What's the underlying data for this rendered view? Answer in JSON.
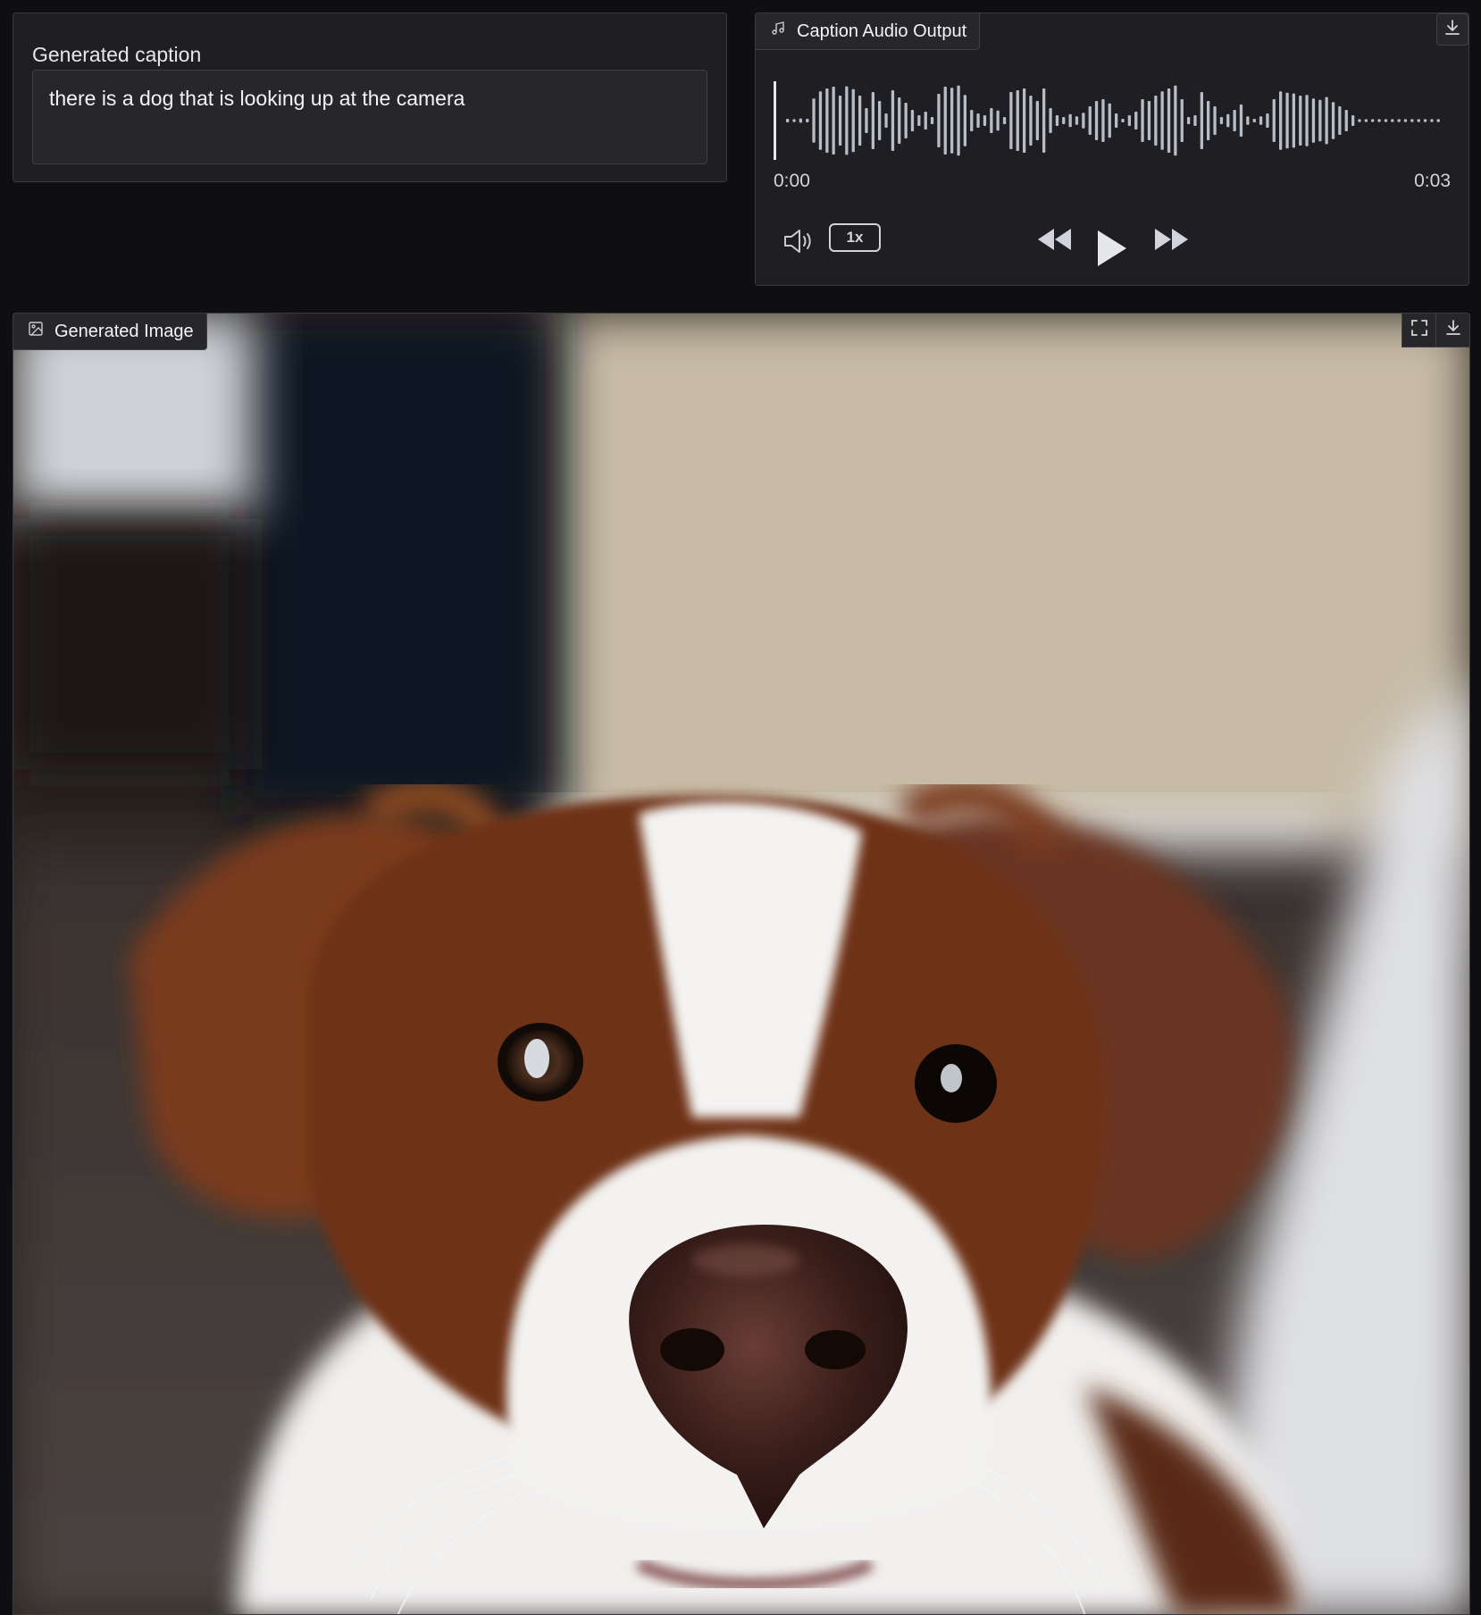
{
  "caption": {
    "label": "Generated caption",
    "text": "there is a dog that is looking up at the camera"
  },
  "audio": {
    "label": "Caption Audio Output",
    "label_icon": "music-note-icon",
    "time_current": "0:00",
    "time_total": "0:03",
    "playback_rate": "1x",
    "progress": 0,
    "waveform": [
      0.05,
      0.04,
      0.06,
      0.05,
      0.62,
      0.82,
      0.9,
      0.95,
      0.7,
      0.96,
      0.88,
      0.7,
      0.35,
      0.8,
      0.55,
      0.2,
      0.85,
      0.65,
      0.5,
      0.3,
      0.15,
      0.25,
      0.1,
      0.75,
      0.95,
      0.92,
      0.98,
      0.72,
      0.3,
      0.2,
      0.15,
      0.35,
      0.28,
      0.1,
      0.8,
      0.85,
      0.9,
      0.7,
      0.55,
      0.9,
      0.35,
      0.15,
      0.1,
      0.18,
      0.12,
      0.22,
      0.4,
      0.55,
      0.6,
      0.48,
      0.2,
      0.05,
      0.15,
      0.25,
      0.6,
      0.55,
      0.7,
      0.82,
      0.9,
      0.98,
      0.6,
      0.1,
      0.15,
      0.8,
      0.55,
      0.4,
      0.1,
      0.18,
      0.3,
      0.45,
      0.12,
      0.05,
      0.12,
      0.2,
      0.6,
      0.82,
      0.78,
      0.76,
      0.7,
      0.72,
      0.62,
      0.58,
      0.66,
      0.52,
      0.4,
      0.3,
      0.15,
      0.04,
      0.04,
      0.04,
      0.04,
      0.04,
      0.04,
      0.04,
      0.04,
      0.04,
      0.04,
      0.04,
      0.04,
      0.04
    ],
    "icons": [
      "volume-icon",
      "rewind-icon",
      "play-icon",
      "fast-forward-icon",
      "download-icon"
    ]
  },
  "image": {
    "label": "Generated Image",
    "label_icon": "image-icon",
    "toolbar_icons": [
      "fullscreen-icon",
      "download-icon"
    ]
  },
  "colors": {
    "background": "#0f0f11",
    "panel": "#1f1f23",
    "border": "#3a3a3f",
    "waveform": "#b8bcc4"
  }
}
